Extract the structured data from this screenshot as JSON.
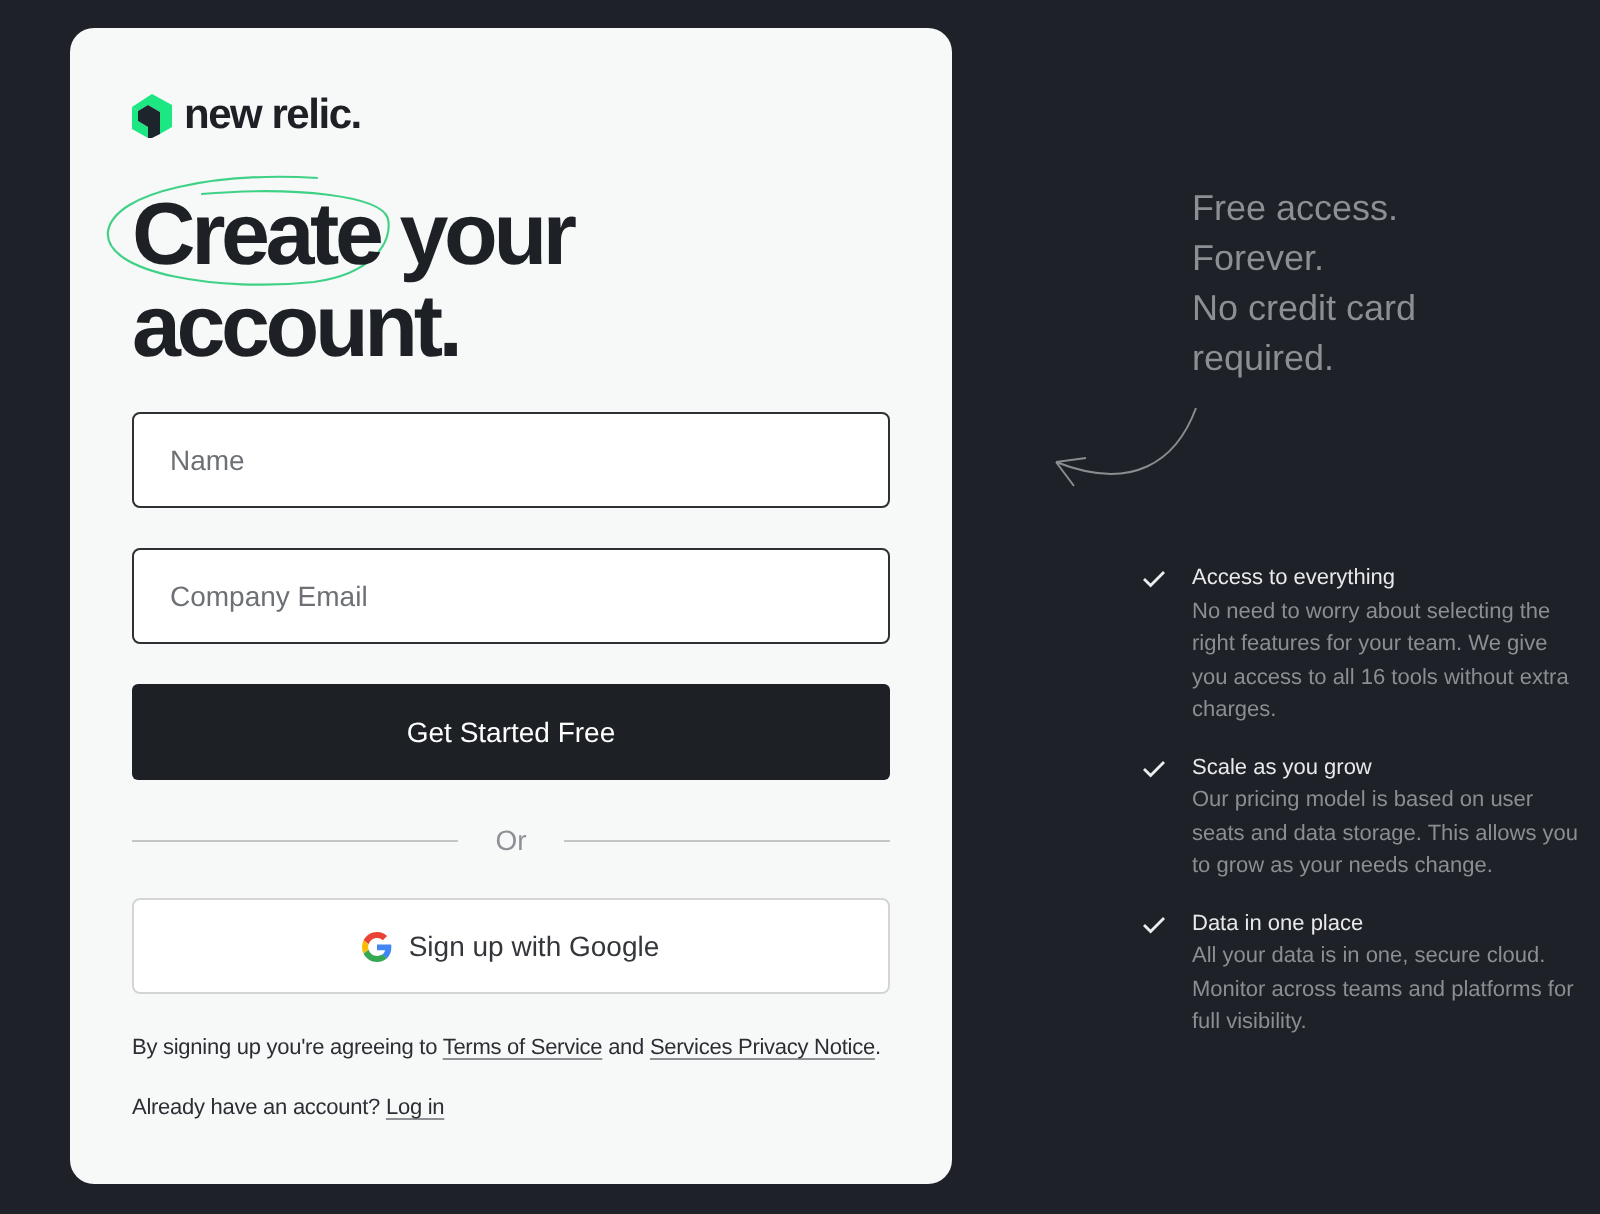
{
  "logo": {
    "text": "new relic."
  },
  "heading": [
    {
      "text": "Create",
      "circled": true
    },
    {
      "text": "your",
      "circled": false
    },
    {
      "text": "account.",
      "circled": false
    }
  ],
  "form": {
    "fields": [
      {
        "placeholder": "Name"
      },
      {
        "placeholder": "Company Email"
      }
    ],
    "submit": "Get Started Free",
    "divider": "Or",
    "google_button": "Sign up with Google"
  },
  "terms": [
    {
      "kind": "text",
      "text": "By signing up you're agreeing to "
    },
    {
      "kind": "link",
      "text": "Terms of Service"
    },
    {
      "kind": "text",
      "text": " and "
    },
    {
      "kind": "link",
      "text": "Services Privacy Notice"
    },
    {
      "kind": "text",
      "text": "."
    }
  ],
  "login_prompt": [
    {
      "kind": "text",
      "text": "Already have an account? "
    },
    {
      "kind": "link",
      "text": "Log in"
    }
  ],
  "tagline": [
    "Free access.",
    "Forever.",
    "No credit card required."
  ],
  "features": [
    {
      "title": "Access to everything",
      "description": "No need to worry about selecting the right features for your team. We give you access to all 16 tools without extra charges."
    },
    {
      "title": "Scale as you grow",
      "description": "Our pricing model is based on user seats and data storage. This allows you to grow as your needs change."
    },
    {
      "title": "Data in one place",
      "description": "All your data is in one, secure cloud. Monitor across teams and platforms for full visibility."
    }
  ]
}
